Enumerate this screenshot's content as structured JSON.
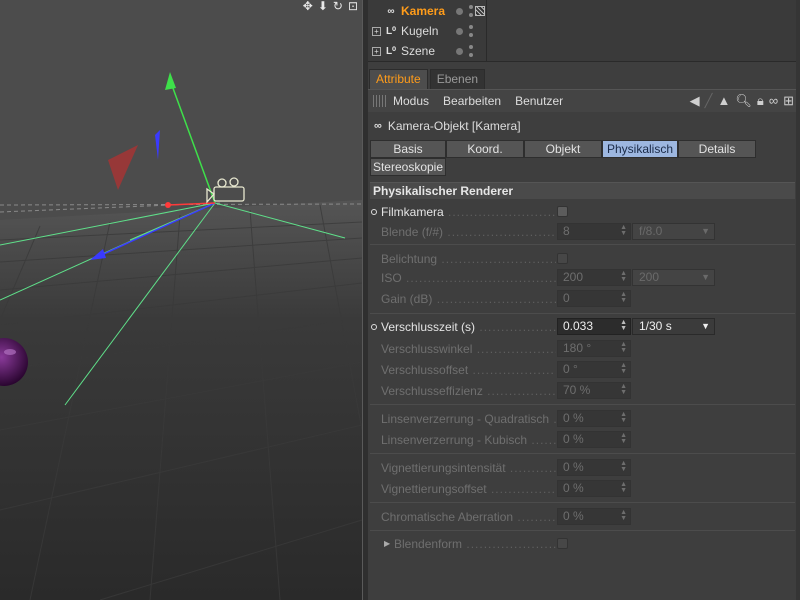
{
  "viewport": {
    "toolbar_icons": [
      "move-icon",
      "down-arrow-icon",
      "rotate-icon",
      "maximize-icon"
    ]
  },
  "object_manager": {
    "rows": [
      {
        "name": "Kamera",
        "selected": true,
        "icon": "camera-icon"
      },
      {
        "name": "Kugeln",
        "selected": false,
        "icon": "null-object-icon"
      },
      {
        "name": "Szene",
        "selected": false,
        "icon": "null-object-icon"
      }
    ]
  },
  "tabs": [
    "Attribute",
    "Ebenen"
  ],
  "menu": [
    "Modus",
    "Bearbeiten",
    "Benutzer"
  ],
  "object_title": "Kamera-Objekt [Kamera]",
  "subtabs": [
    "Basis",
    "Koord.",
    "Objekt",
    "Physikalisch",
    "Details",
    "Stereoskopie"
  ],
  "section": "Physikalischer Renderer",
  "props": {
    "filmkamera": "Filmkamera",
    "blende": {
      "label": "Blende (f/#)",
      "value": "8",
      "preset": "f/8.0"
    },
    "belichtung": "Belichtung",
    "iso": {
      "label": "ISO",
      "value": "200",
      "preset": "200"
    },
    "gain": {
      "label": "Gain (dB)",
      "value": "0"
    },
    "verschlusszeit": {
      "label": "Verschlusszeit (s)",
      "value": "0.033",
      "preset": "1/30 s"
    },
    "verschlusswinkel": {
      "label": "Verschlusswinkel",
      "value": "180 °"
    },
    "verschlussoffset": {
      "label": "Verschlussoffset",
      "value": "0 °"
    },
    "verschlusseffizienz": {
      "label": "Verschlusseffizienz",
      "value": "70 %"
    },
    "linsen_quad": {
      "label": "Linsenverzerrung - Quadratisch",
      "value": "0 %"
    },
    "linsen_kub": {
      "label": "Linsenverzerrung - Kubisch",
      "value": "0 %"
    },
    "vign_int": {
      "label": "Vignettierungsintensität",
      "value": "0 %"
    },
    "vign_off": {
      "label": "Vignettierungsoffset",
      "value": "0 %"
    },
    "chrom": {
      "label": "Chromatische Aberration",
      "value": "0 %"
    },
    "blendenform": "Blendenform"
  },
  "colors": {
    "accent": "#ff9c1a",
    "active_subtab": "#9db7e0"
  }
}
